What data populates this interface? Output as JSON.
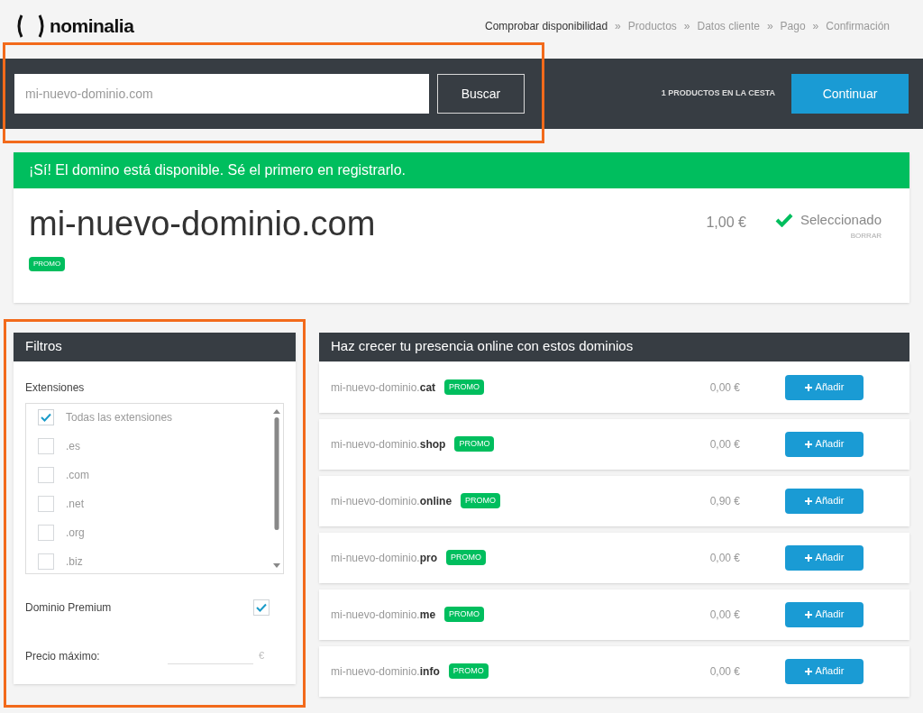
{
  "header": {
    "logo_text": "nominalia",
    "breadcrumb_separator": "»",
    "steps": [
      {
        "label": "Comprobar disponibilidad",
        "selected": true
      },
      {
        "label": "Productos",
        "selected": false
      },
      {
        "label": "Datos cliente",
        "selected": false
      },
      {
        "label": "Pago",
        "selected": false
      },
      {
        "label": "Confirmación",
        "selected": false
      }
    ]
  },
  "search_bar": {
    "value": "mi-nuevo-dominio.com",
    "button": "Buscar",
    "cart_count": "1 PRODUCTOS EN LA CESTA",
    "continue_button": "Continuar"
  },
  "result": {
    "banner": "¡Sí! El domino está disponible. Sé el primero en registrarlo.",
    "domain": "mi-nuevo-dominio.com",
    "badge": "PROMO",
    "price": "1,00 €",
    "selected": true,
    "status": "Seleccionado",
    "remove_link": "BORRAR"
  },
  "filters": {
    "title": "Filtros",
    "extensions_label": "Extensiones",
    "extensions": [
      {
        "label": "Todas las extensiones",
        "checked": true
      },
      {
        "label": ".es",
        "checked": false
      },
      {
        "label": ".com",
        "checked": false
      },
      {
        "label": ".net",
        "checked": false
      },
      {
        "label": ".org",
        "checked": false
      },
      {
        "label": ".biz",
        "checked": false
      }
    ],
    "premium": {
      "label": "Dominio Premium",
      "checked": true
    },
    "max_price": {
      "label": "Precio máximo:",
      "unit": "€"
    }
  },
  "suggestions": {
    "title": "Haz crecer tu presencia online con estos dominios",
    "rows": [
      {
        "domain": "mi-nuevo-dominio.**cat**",
        "badge": "PROMO",
        "price": "0,00 €",
        "button": "Añadir"
      },
      {
        "domain": "mi-nuevo-dominio.**shop**",
        "badge": "PROMO",
        "price": "0,00 €",
        "button": "Añadir"
      },
      {
        "domain": "mi-nuevo-dominio.**online**",
        "badge": "PROMO",
        "price": "0,90 €",
        "button": "Añadir"
      },
      {
        "domain": "mi-nuevo-dominio.**pro**",
        "badge": "PROMO",
        "price": "0,00 €",
        "button": "Añadir"
      },
      {
        "domain": "mi-nuevo-dominio.**me**",
        "badge": "PROMO",
        "price": "0,00 €",
        "button": "Añadir"
      },
      {
        "domain": "mi-nuevo-dominio.**info**",
        "badge": "PROMO",
        "price": "0,00 €",
        "button": "Añadir"
      }
    ]
  }
}
